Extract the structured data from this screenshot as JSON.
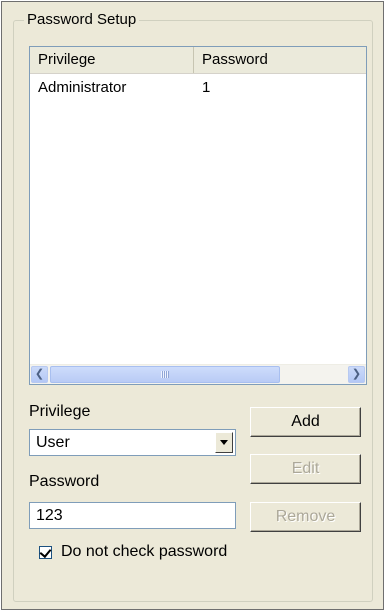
{
  "group": {
    "title": "Password Setup"
  },
  "list": {
    "columns": [
      "Privilege",
      "Password"
    ],
    "rows": [
      {
        "privilege": "Administrator",
        "password": "1"
      }
    ]
  },
  "form": {
    "privilege_label": "Privilege",
    "privilege_selected": "User",
    "password_label": "Password",
    "password_value": "123",
    "checkbox_label": "Do not check password",
    "checkbox_checked": true
  },
  "buttons": {
    "add": "Add",
    "edit": "Edit",
    "remove": "Remove"
  },
  "icons": {
    "scroll_left": "chevron-left-icon",
    "scroll_right": "chevron-right-icon",
    "dropdown": "chevron-down-icon",
    "check": "checkmark-icon"
  },
  "colors": {
    "panel_bg": "#ECE9D8",
    "input_border": "#7f9db9",
    "disabled_text": "#aca899"
  }
}
